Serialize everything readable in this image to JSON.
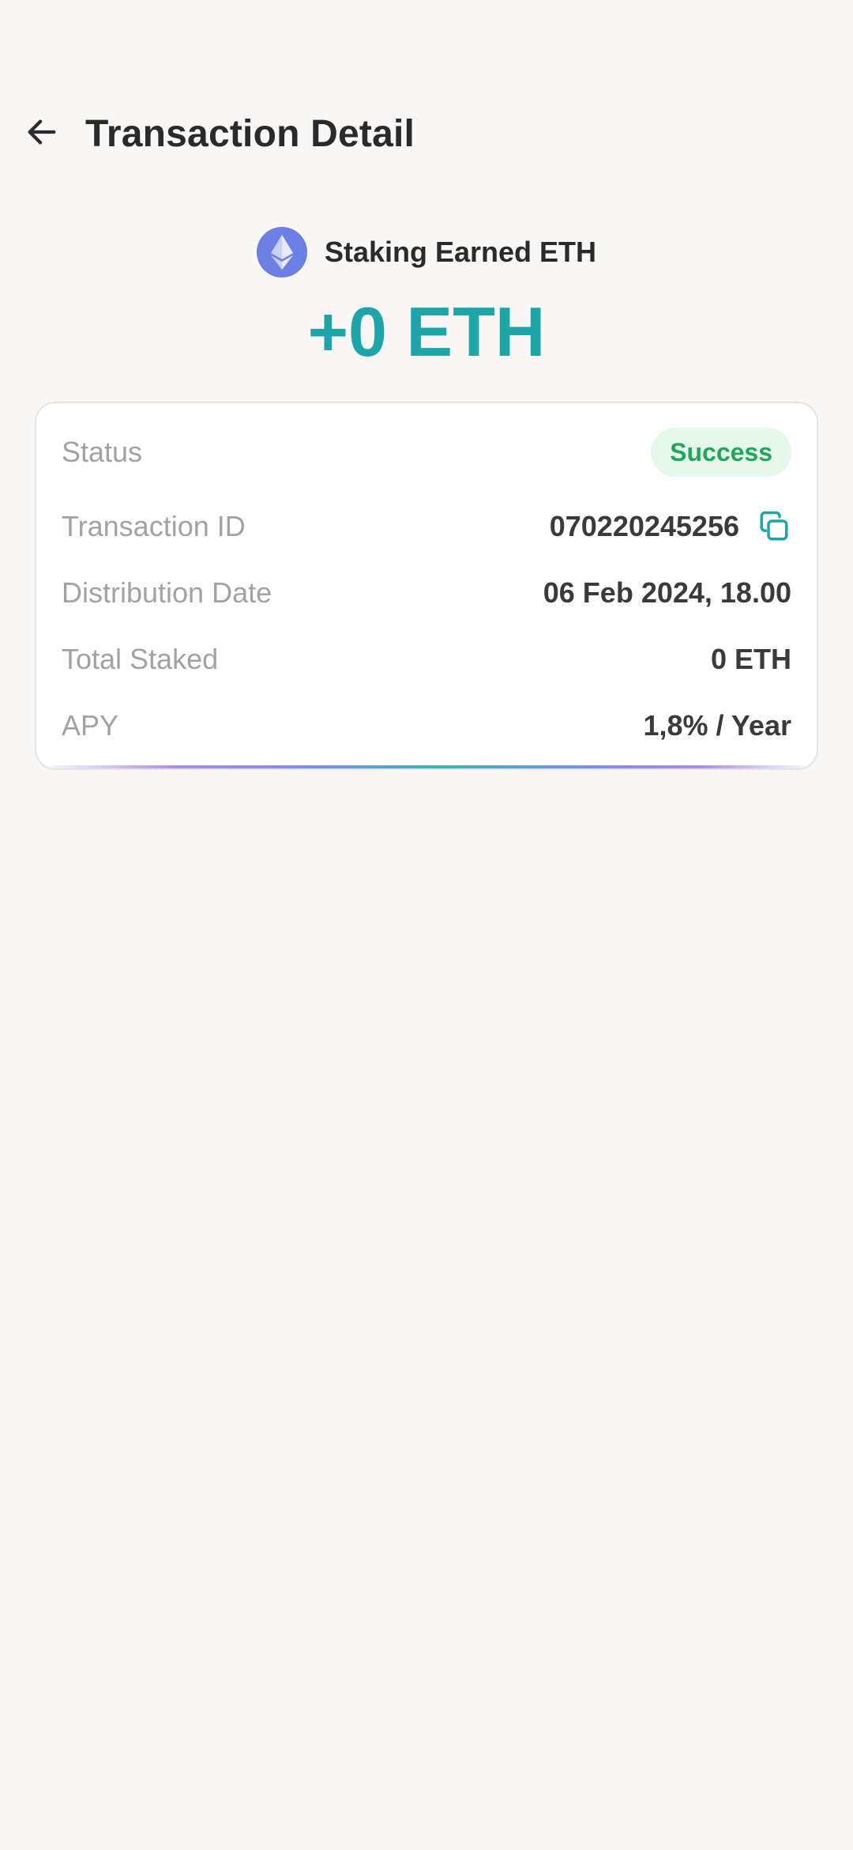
{
  "header": {
    "title": "Transaction Detail",
    "back_icon": "arrow-left-icon"
  },
  "hero": {
    "coin_icon": "ethereum-icon",
    "label": "Staking Earned ETH",
    "amount": "+0 ETH"
  },
  "details": {
    "status": {
      "label": "Status",
      "value": "Success"
    },
    "transaction_id": {
      "label": "Transaction ID",
      "value": "070220245256",
      "copy_icon": "copy-icon"
    },
    "distribution_date": {
      "label": "Distribution Date",
      "value": "06 Feb 2024, 18.00"
    },
    "total_staked": {
      "label": "Total Staked",
      "value": "0 ETH"
    },
    "apy": {
      "label": "APY",
      "value": "1,8% / Year"
    }
  },
  "colors": {
    "accent_teal": "#1fa5a8",
    "success_green": "#21a65a",
    "success_bg": "#e6f7ec",
    "eth_blue": "#6e7fe3",
    "background": "#f8f7f6"
  }
}
